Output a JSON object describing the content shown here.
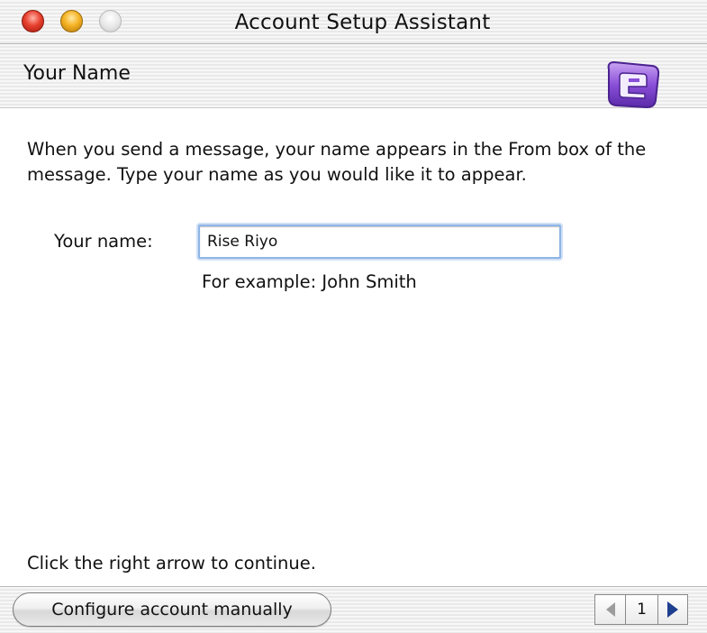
{
  "window": {
    "title": "Account Setup Assistant"
  },
  "header": {
    "section_title": "Your Name",
    "app_icon": "entourage-app-icon"
  },
  "content": {
    "description": "When you send a message, your name appears in the From box of the message. Type your name as you would like it to appear.",
    "name_label": "Your name:",
    "name_value": "Rise Riyo",
    "example": "For example: John Smith",
    "continue_hint": "Click the right arrow to continue."
  },
  "footer": {
    "configure_label": "Configure account manually",
    "page_number": "1",
    "prev_icon": "left-arrow-icon",
    "next_icon": "right-arrow-icon"
  },
  "colors": {
    "close": "#e8412f",
    "minimize": "#f5b324",
    "focus_ring": "#8fb5e6",
    "icon_purple": "#8a4fd8",
    "next_arrow": "#1f3f8f"
  }
}
